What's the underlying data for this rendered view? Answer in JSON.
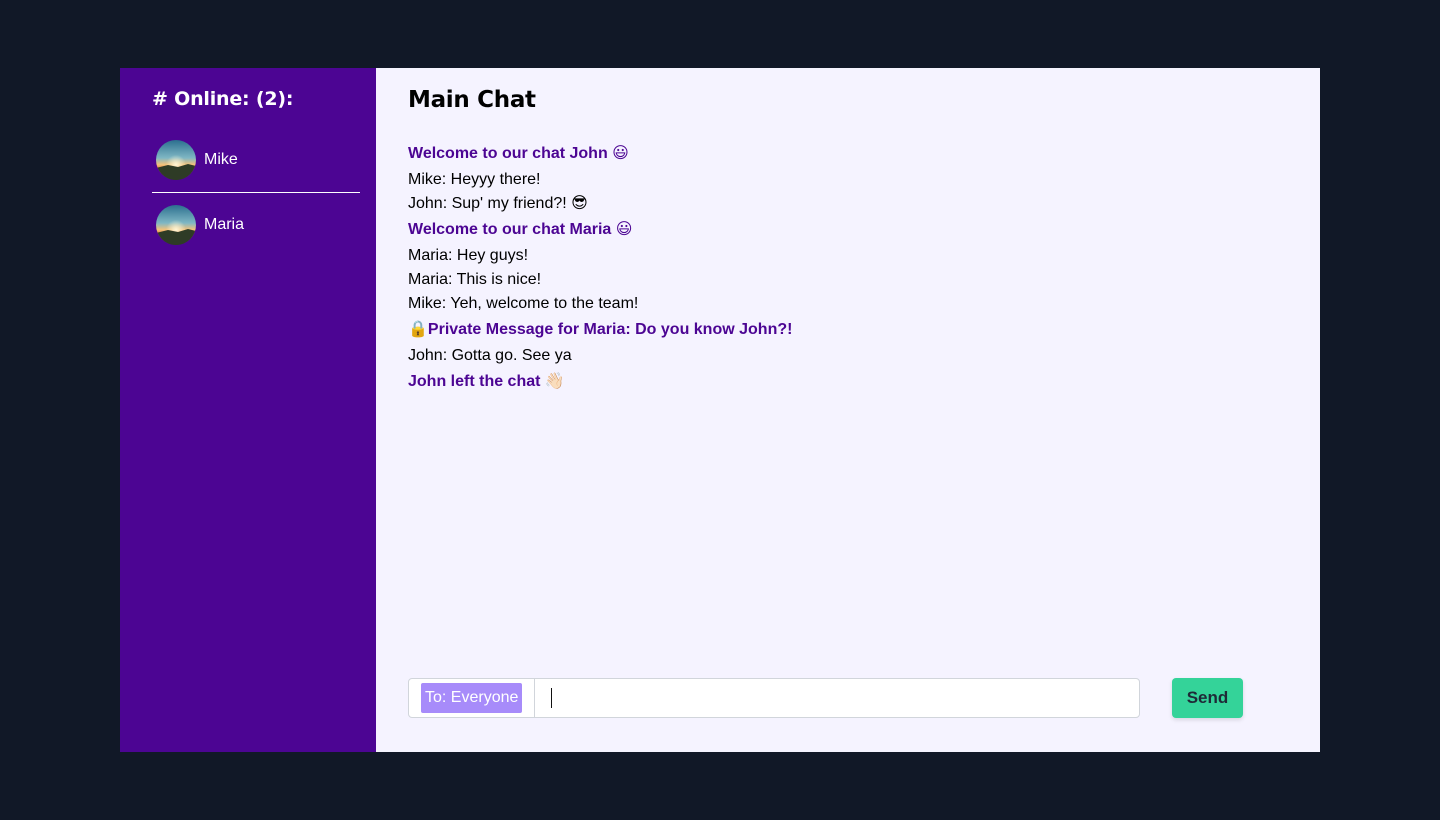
{
  "sidebar": {
    "title": "# Online: (2):",
    "users": [
      {
        "name": "Mike"
      },
      {
        "name": "Maria"
      }
    ]
  },
  "main": {
    "title": "Main Chat",
    "messages": [
      {
        "type": "system",
        "text": "Welcome to our chat John 😃"
      },
      {
        "type": "user",
        "text": "Mike: Heyyy there!"
      },
      {
        "type": "user",
        "text": "John: Sup' my friend?! 😎"
      },
      {
        "type": "system",
        "text": "Welcome to our chat Maria 😃"
      },
      {
        "type": "user",
        "text": "Maria: Hey guys!"
      },
      {
        "type": "user",
        "text": "Maria: This is nice!"
      },
      {
        "type": "user",
        "text": "Mike: Yeh, welcome to the team!"
      },
      {
        "type": "system",
        "text": "🔒Private Message for Maria: Do you know John?!"
      },
      {
        "type": "user",
        "text": "John: Gotta go. See ya"
      },
      {
        "type": "system",
        "text": "John left the chat 👋🏻"
      }
    ]
  },
  "composer": {
    "recipient": "To: Everyone",
    "input_value": "",
    "send_label": "Send"
  },
  "colors": {
    "background": "#111827",
    "sidebar": "#4c0593",
    "main": "#f5f3ff",
    "system_text": "#4c0593",
    "recipient_tag": "#a78bfa",
    "send_button": "#34d399"
  }
}
